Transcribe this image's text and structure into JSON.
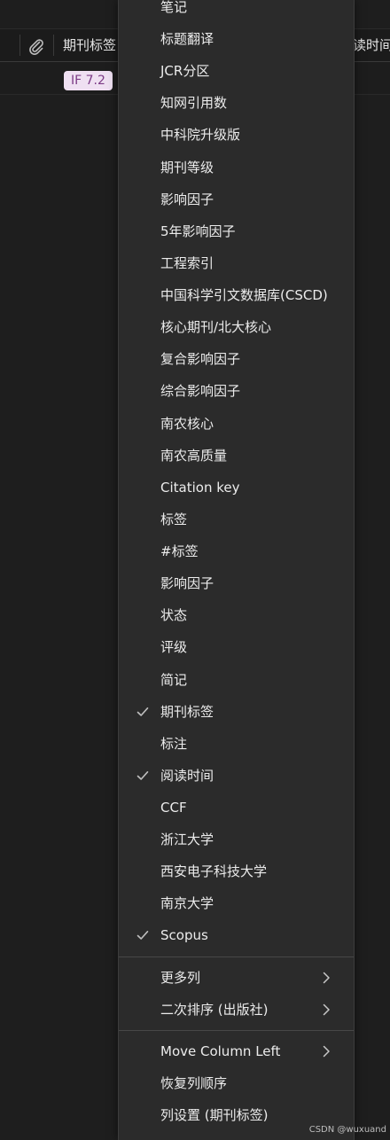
{
  "table": {
    "headers": [
      "期刊标签",
      "读时间"
    ],
    "row_badge": "IF 7.2"
  },
  "menu": {
    "items": [
      {
        "label": "笔记",
        "checked": false
      },
      {
        "label": "标题翻译",
        "checked": false
      },
      {
        "label": "JCR分区",
        "checked": false
      },
      {
        "label": "知网引用数",
        "checked": false
      },
      {
        "label": "中科院升级版",
        "checked": false
      },
      {
        "label": "期刊等级",
        "checked": false
      },
      {
        "label": "影响因子",
        "checked": false
      },
      {
        "label": "5年影响因子",
        "checked": false
      },
      {
        "label": "工程索引",
        "checked": false
      },
      {
        "label": "中国科学引文数据库(CSCD)",
        "checked": false
      },
      {
        "label": "核心期刊/北大核心",
        "checked": false
      },
      {
        "label": "复合影响因子",
        "checked": false
      },
      {
        "label": "综合影响因子",
        "checked": false
      },
      {
        "label": "南农核心",
        "checked": false
      },
      {
        "label": "南农高质量",
        "checked": false
      },
      {
        "label": "Citation key",
        "checked": false
      },
      {
        "label": "标签",
        "checked": false
      },
      {
        "label": "#标签",
        "checked": false
      },
      {
        "label": "影响因子",
        "checked": false
      },
      {
        "label": "状态",
        "checked": false
      },
      {
        "label": "评级",
        "checked": false
      },
      {
        "label": "简记",
        "checked": false
      },
      {
        "label": "期刊标签",
        "checked": true
      },
      {
        "label": "标注",
        "checked": false
      },
      {
        "label": "阅读时间",
        "checked": true
      },
      {
        "label": "CCF",
        "checked": false
      },
      {
        "label": "浙江大学",
        "checked": false
      },
      {
        "label": "西安电子科技大学",
        "checked": false
      },
      {
        "label": "南京大学",
        "checked": false
      },
      {
        "label": "Scopus",
        "checked": true
      }
    ],
    "submenu_items": [
      {
        "label": "更多列",
        "has_submenu": true
      },
      {
        "label": "二次排序 (出版社)",
        "has_submenu": true
      }
    ],
    "footer_items": [
      {
        "label": "Move Column Left",
        "has_submenu": true
      },
      {
        "label": "恢复列顺序",
        "has_submenu": false
      },
      {
        "label": "列设置 (期刊标签)",
        "has_submenu": false
      }
    ]
  },
  "watermark": "CSDN @wuxuand",
  "icons": {
    "attachment": "paperclip-icon",
    "check": "check-icon",
    "chevron": "chevron-right-icon"
  },
  "colors": {
    "menu_bg": "#2b2b2b",
    "page_bg": "#1e1e1e",
    "badge_bg": "#efe0f2",
    "badge_text": "#7c3b86"
  }
}
